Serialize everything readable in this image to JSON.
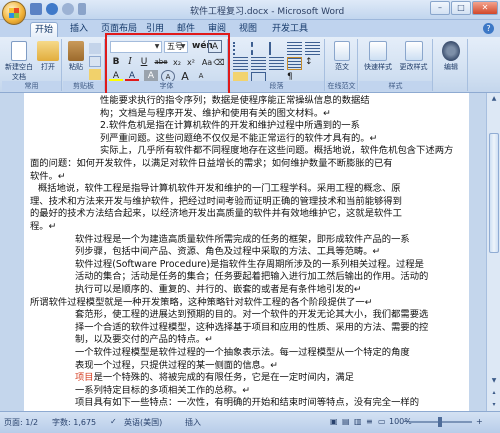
{
  "window": {
    "title": "软件工程复习.docx - Microsoft Word"
  },
  "tabs": [
    "开始",
    "插入",
    "页面布局",
    "引用",
    "邮件",
    "审阅",
    "视图",
    "开发工具"
  ],
  "ribbon": {
    "groups": {
      "common": {
        "label": "常用",
        "new_label": "新建空白文档",
        "open_label": "打开"
      },
      "clipboard": {
        "label": "剪贴板",
        "paste_label": "粘贴"
      },
      "font": {
        "label": "字体",
        "font_name": "",
        "font_size": "五号"
      },
      "paragraph": {
        "label": "段落"
      },
      "fanwen": {
        "label": "范文"
      },
      "online": {
        "label": "在线范文",
        "button_label": "范文"
      },
      "styles": {
        "label": "样式",
        "quick_styles_label": "快速样式",
        "change_styles_label": "更改样式"
      },
      "editing": {
        "label": "编辑"
      }
    },
    "font_buttons": [
      "B",
      "I",
      "U",
      "abe",
      "x₂",
      "x²",
      "Aa",
      "A",
      "A",
      "A",
      "A",
      "A"
    ],
    "highlight_color": "#e01a1a"
  },
  "document": {
    "lines": [
      {
        "indent": 70,
        "text": "性能要求执行的指令序列；数据是使程序能正常操纵信息的数据结"
      },
      {
        "indent": 70,
        "text": "构；文档是与程序开发、维护和使用有关的图文材料。↵"
      },
      {
        "indent": 70,
        "text": "2.软件危机是指在计算机软件的开发和维护过程中所遇到的一系"
      },
      {
        "indent": 70,
        "text": "列严重问题。这些问题绝不仅仅是不能正常运行的软件才具有的。↵"
      },
      {
        "indent": 70,
        "text": "实际上，几乎所有软件都不同程度地存在这些问题。概括地说，软件危机包含下述两方"
      },
      {
        "indent": 0,
        "text": "面的问题：如何开发软件，以满足对软件日益增长的需求；如何维护数量不断膨胀的已有"
      },
      {
        "indent": 0,
        "text": "软件。↵"
      },
      {
        "indent": 8,
        "text": "概括地说，软件工程是指导计算机软件开发和维护的一门工程学科。采用工程的概念、原"
      },
      {
        "indent": 0,
        "text": "理、技术和方法来开发与维护软件，把经过时间考验而证明正确的管理技术和当前能够得到"
      },
      {
        "indent": 0,
        "text": "的最好的技术方法结合起来，以经济地开发出高质量的软件并有效地维护它，这就是软件工"
      },
      {
        "indent": 0,
        "text": "程。↵"
      },
      {
        "indent": 45,
        "text": "软件过程是一个为建造高质量软件所需完成的任务的框架，即形成软件产品的一系"
      },
      {
        "indent": 45,
        "text": "列步骤，包括中间产品、资源、角色及过程中采取的方法、工具等范畴。↵"
      },
      {
        "indent": 45,
        "text": "软件过程(Software Procedure)是指软件生存周期所涉及的一系列相关过程。过程是"
      },
      {
        "indent": 45,
        "text": "活动的集合；活动是任务的集合；任务要起着把输入进行加工然后输出的作用。活动的"
      },
      {
        "indent": 45,
        "text": "执行可以是顺序的、重复的、并行的、嵌套的或者是有条件地引发的↵"
      },
      {
        "indent": 0,
        "text": "所谓软件过程模型就是一种开发策略，这种策略针对软件工程的各个阶段提供了一↵"
      },
      {
        "indent": 45,
        "text": "套范形，使工程的进展达到预期的目的。对一个软件的开发无论其大小，我们都需要选"
      },
      {
        "indent": 45,
        "text": "择一个合适的软件过程模型，这种选择基于项目和应用的性质、采用的方法、需要的控"
      },
      {
        "indent": 45,
        "text": "制，以及要交付的产品的特点。↵"
      },
      {
        "indent": 45,
        "text": "一个软件过程模型是软件过程的一个抽象表示法。每一过程模型从一个特定的角度"
      },
      {
        "indent": 45,
        "text": "表现一个过程，只提供过程的某一侧面的信息。↵"
      },
      {
        "indent": 45,
        "pre": "项目",
        "text": "是一个特殊的、将被完成的有限任务，它是在一定时间内，满足"
      },
      {
        "indent": 45,
        "text": "一系列特定目标的多项相关工作的总称。↵"
      },
      {
        "indent": 45,
        "text": "项目具有如下一些特点：一次性，有明确的开始和结束时间等特点，没有完全一样的"
      }
    ]
  },
  "status": {
    "page": "页面: 1/2",
    "words": "字数: 1,675",
    "language": "英语(美国)",
    "mode": "插入",
    "zoom": "100%"
  },
  "colors": {
    "ribbon_bg": "#dbe6f4",
    "doc_bg": "#ffffff",
    "red_annotation": "#e01a1a",
    "red_text": "#d43a1c"
  }
}
